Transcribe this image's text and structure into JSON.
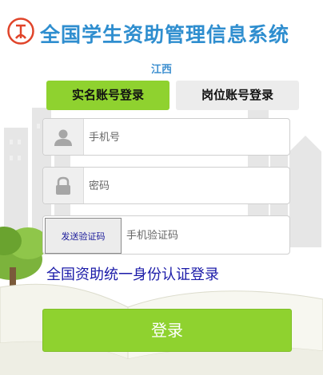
{
  "header": {
    "logo_icon": "student-aid-logo-icon",
    "title": "全国学生资助管理信息系统",
    "region": "江西"
  },
  "tabs": [
    {
      "label": "实名账号登录",
      "active": true
    },
    {
      "label": "岗位账号登录",
      "active": false
    }
  ],
  "form": {
    "phone": {
      "icon": "user-icon",
      "placeholder": "手机号",
      "value": ""
    },
    "password": {
      "icon": "lock-icon",
      "placeholder": "密码",
      "value": ""
    },
    "sms": {
      "button_label": "发送验证码",
      "placeholder": "手机验证码",
      "value": ""
    },
    "id_auth_link": "全国资助统一身份认证登录",
    "submit_label": "登录"
  },
  "colors": {
    "accent_green": "#8fd22f",
    "title_blue": "#2f8ecf",
    "link_blue": "#1a1aa8"
  }
}
